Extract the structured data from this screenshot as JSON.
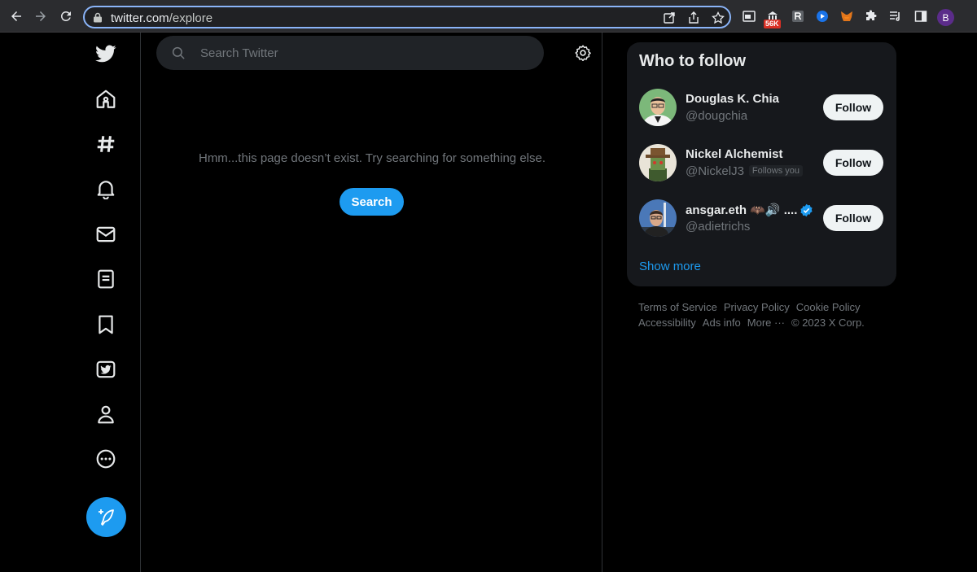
{
  "browser": {
    "url_host": "twitter.com",
    "url_path": "/explore",
    "extension_badge": "56K",
    "profile_initial": "B"
  },
  "search": {
    "placeholder": "Search Twitter"
  },
  "main": {
    "empty_message": "Hmm...this page doesn’t exist. Try searching for something else.",
    "search_button": "Search"
  },
  "who_to_follow": {
    "title": "Who to follow",
    "users": [
      {
        "name": "Douglas K. Chia",
        "handle": "@dougchia",
        "follow_label": "Follow"
      },
      {
        "name": "Nickel Alchemist",
        "handle": "@NickelJ3",
        "badge": "Follows you",
        "follow_label": "Follow"
      },
      {
        "name": "ansgar.eth 🦇🔊 ....",
        "handle": "@adietrichs",
        "follow_label": "Follow"
      }
    ],
    "show_more": "Show more"
  },
  "footer": {
    "links": [
      "Terms of Service",
      "Privacy Policy",
      "Cookie Policy",
      "Accessibility",
      "Ads info",
      "More ···",
      "© 2023 X Corp."
    ]
  },
  "colors": {
    "accent": "#1d9bf0",
    "background": "#000000",
    "card": "#16181c",
    "muted_text": "#71767b"
  },
  "icons": {
    "sidebar": [
      "twitter-logo-icon",
      "home-icon",
      "hashtag-icon",
      "bell-icon",
      "mail-icon",
      "lists-icon",
      "bookmark-icon",
      "twitter-blue-icon",
      "profile-icon",
      "more-circle-icon"
    ],
    "compose": "compose-tweet-icon"
  }
}
